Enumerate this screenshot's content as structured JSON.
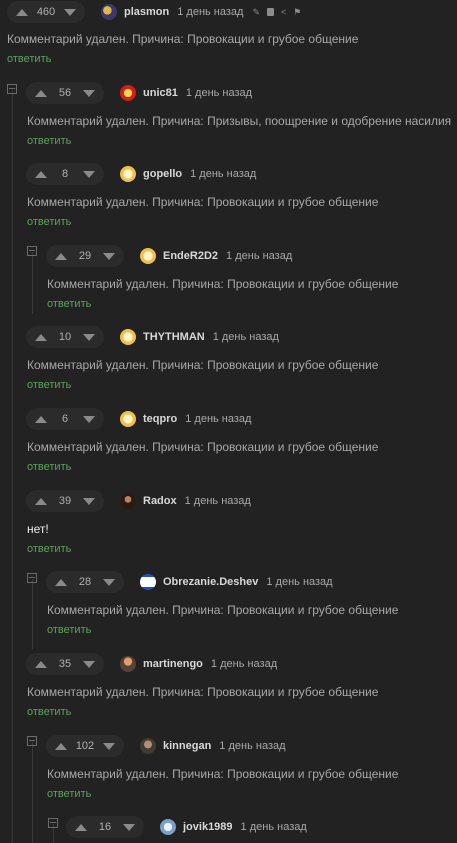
{
  "reply_label": "ответить",
  "comments": [
    {
      "score": "460",
      "user": "plasmon",
      "time": "1 день назад",
      "text": "Комментарий удален. Причина: Провокации и грубое общение"
    },
    {
      "score": "56",
      "user": "unic81",
      "time": "1 день назад",
      "text": "Комментарий удален. Причина: Призывы, поощрение и одобрение насилия"
    },
    {
      "score": "8",
      "user": "gopello",
      "time": "1 день назад",
      "text": "Комментарий удален. Причина: Провокации и грубое общение"
    },
    {
      "score": "29",
      "user": "EndeR2D2",
      "time": "1 день назад",
      "text": "Комментарий удален. Причина: Провокации и грубое общение"
    },
    {
      "score": "10",
      "user": "THYTHMAN",
      "time": "1 день назад",
      "text": "Комментарий удален. Причина: Провокации и грубое общение"
    },
    {
      "score": "6",
      "user": "teqpro",
      "time": "1 день назад",
      "text": "Комментарий удален. Причина: Провокации и грубое общение"
    },
    {
      "score": "39",
      "user": "Radox",
      "time": "1 день назад",
      "text": "нет!"
    },
    {
      "score": "28",
      "user": "Obrezanie.Deshev",
      "time": "1 день назад",
      "text": "Комментарий удален. Причина: Провокации и грубое общение"
    },
    {
      "score": "35",
      "user": "martinengo",
      "time": "1 день назад",
      "text": "Комментарий удален. Причина: Провокации и грубое общение"
    },
    {
      "score": "102",
      "user": "kinnegan",
      "time": "1 день назад",
      "text": "Комментарий удален. Причина: Провокации и грубое общение"
    },
    {
      "score": "16",
      "user": "jovik1989",
      "time": "1 день назад",
      "text": ""
    }
  ],
  "colors": {
    "background": "#222222",
    "reply": "#5aa45a",
    "username": "#d8d8d8"
  },
  "icons": [
    "arrow-up-icon",
    "arrow-down-icon",
    "edit-icon",
    "save-icon",
    "share-icon",
    "flag-icon",
    "collapse-icon"
  ]
}
